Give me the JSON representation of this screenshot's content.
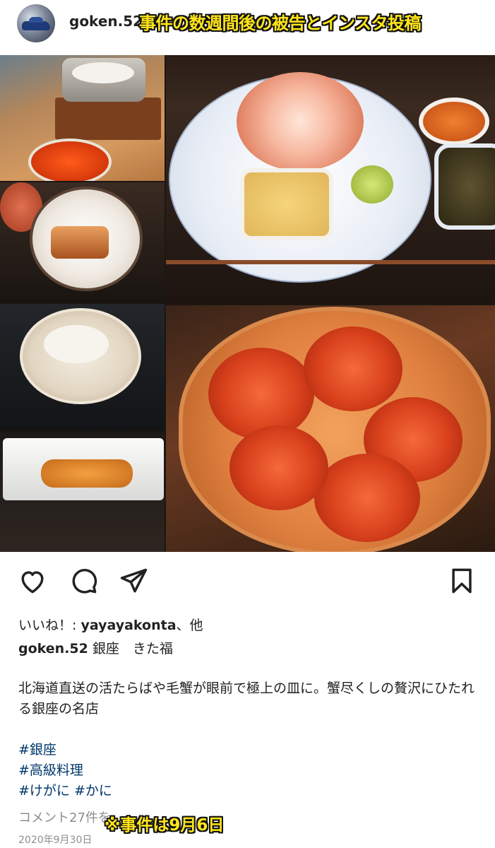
{
  "post": {
    "username": "goken.52",
    "caption_overlay": "事件の数週間後の被告とインスタ投稿"
  },
  "photos": [
    {
      "name": "rice-pot-and-ikura"
    },
    {
      "name": "kegani-plate"
    },
    {
      "name": "unagi-rice-bowl"
    },
    {
      "name": "fish-soup"
    },
    {
      "name": "uni-tempura"
    },
    {
      "name": "kegani-tub"
    }
  ],
  "actions": {
    "like": "heart-icon",
    "comment": "comment-icon",
    "share": "send-icon",
    "save": "bookmark-icon"
  },
  "likes": {
    "prefix": "いいね！: ",
    "user": "yayayakonta",
    "suffix": "、他"
  },
  "caption": {
    "username": "goken.52",
    "location": "銀座　きた福",
    "text": "北海道直送の活たらばや毛蟹が眼前で極上の皿に。蟹尽くしの贅沢にひたれる銀座の名店",
    "hashtags": [
      "#銀座",
      "#高級料理",
      "#けがに #かに"
    ]
  },
  "comments": {
    "label": "コメント27件を…"
  },
  "note_overlay": "※事件は9月6日",
  "date": "2020年9月30日",
  "colors": {
    "overlay_text": "#ffe51a",
    "hashtag": "#00376b",
    "muted": "#8e8e8e"
  }
}
